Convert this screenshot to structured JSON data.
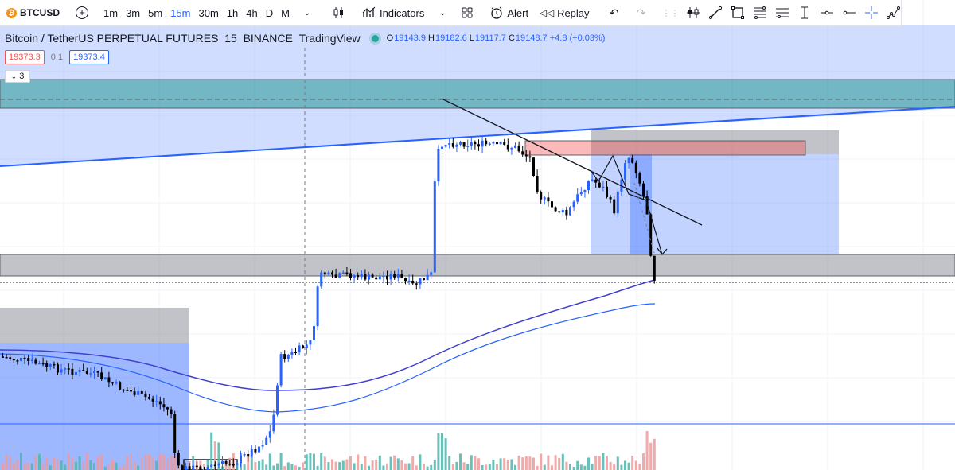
{
  "toolbar": {
    "symbol": "BTCUSD",
    "timeframes": [
      "1m",
      "3m",
      "5m",
      "15m",
      "30m",
      "1h",
      "4h",
      "D",
      "M"
    ],
    "active_timeframe": "15m",
    "indicators_label": "Indicators",
    "alert_label": "Alert",
    "replay_label": "Replay",
    "icons": [
      "plus-circle-icon",
      "chevron-down-icon",
      "candles-icon",
      "indicators-icon",
      "layout-icon",
      "alarm-clock-icon",
      "rewind-icon",
      "undo-icon",
      "redo-icon",
      "grip-icon",
      "long-position-icon",
      "trend-line-icon",
      "rectangle-icon",
      "fib-icon",
      "pitchfork-icon",
      "price-range-icon",
      "horizontal-ray-icon",
      "horizontal-line-icon",
      "crosshair-icon",
      "path-icon"
    ]
  },
  "legend": {
    "title": "Bitcoin / TetherUS PERPETUAL FUTURES",
    "interval": "15",
    "exchange": "BINANCE",
    "source": "TradingView",
    "open_label": "O",
    "open": "19143.9",
    "high_label": "H",
    "high": "19182.6",
    "low_label": "L",
    "low": "19117.7",
    "close_label": "C",
    "close": "19148.7",
    "change": "+4.8 (+0.03%)",
    "live_color": "#26a69a"
  },
  "quote": {
    "sell": "19373.3",
    "spread": "0.1",
    "buy": "19373.4"
  },
  "indicator_toggle": {
    "label": "3"
  },
  "colors": {
    "up": "#2962ff",
    "down": "#000000",
    "vol_up": "#4db6ac",
    "vol_down": "#ef9a9a",
    "zone_blue": "rgba(41,98,255,0.22)",
    "zone_green": "rgba(0,137,123,0.45)",
    "zone_gray": "rgba(120,123,134,0.45)",
    "zone_red": "rgba(239,83,80,0.40)"
  }
}
